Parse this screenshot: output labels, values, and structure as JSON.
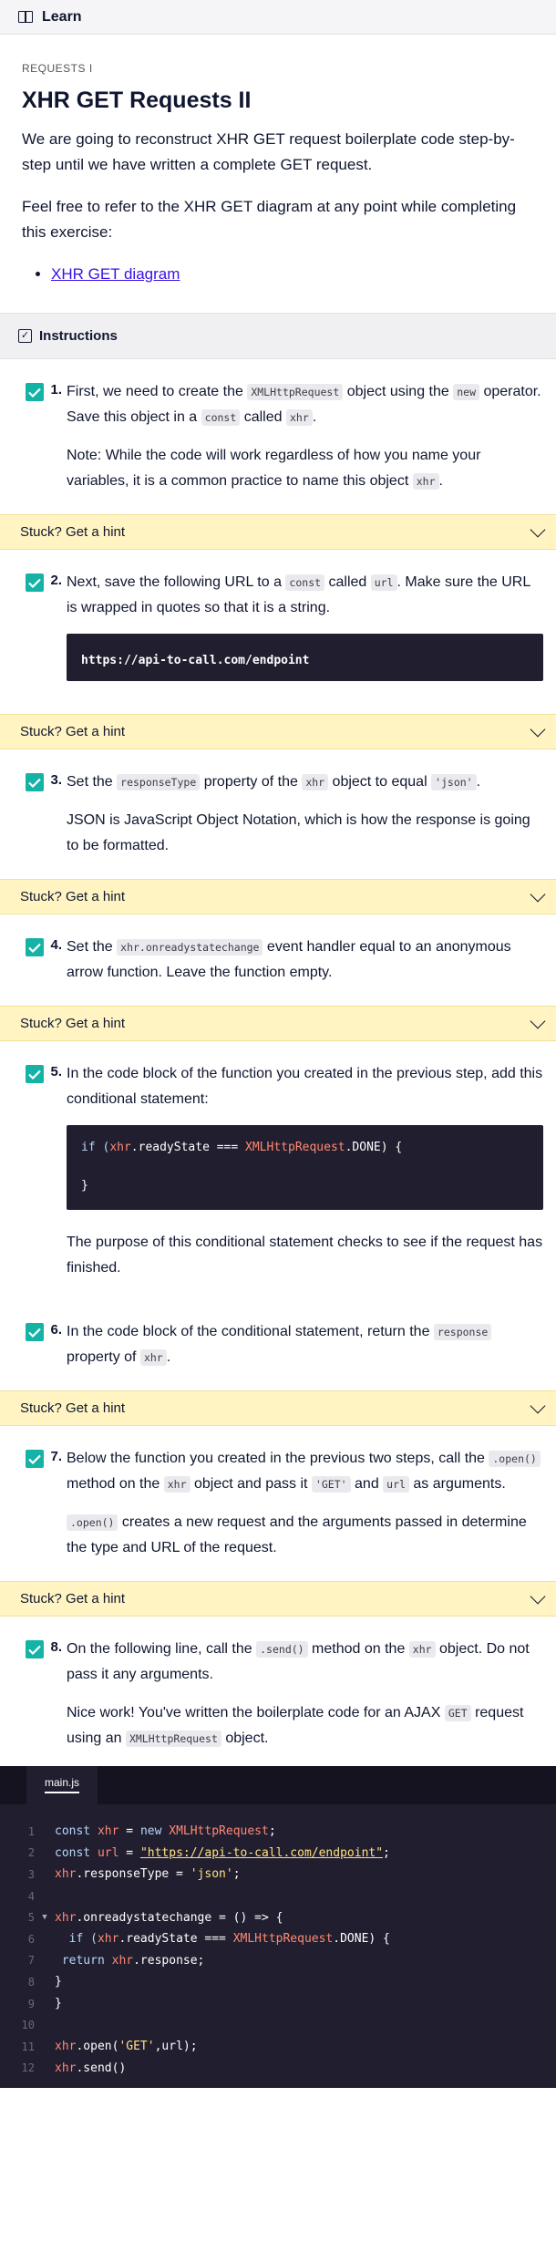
{
  "topbar": {
    "title": "Learn"
  },
  "learn": {
    "eyebrow": "REQUESTS I",
    "title": "XHR GET Requests II",
    "para1": "We are going to reconstruct XHR GET request boilerplate code step-by-step until we have written a complete GET request.",
    "para2": "Feel free to refer to the XHR GET diagram at any point while completing this exercise:",
    "link": "XHR GET diagram"
  },
  "instructions": {
    "title": "Instructions"
  },
  "hint_label": "Stuck? Get a hint",
  "tasks": [
    {
      "num": "1.",
      "status": "complete"
    },
    {
      "num": "2.",
      "status": "complete"
    },
    {
      "num": "3.",
      "status": "complete"
    },
    {
      "num": "4.",
      "status": "complete"
    },
    {
      "num": "5.",
      "status": "complete"
    },
    {
      "num": "6.",
      "status": "complete"
    },
    {
      "num": "7.",
      "status": "complete"
    },
    {
      "num": "8.",
      "status": "complete"
    }
  ],
  "t1": {
    "a": "First, we need to create the ",
    "b": "XMLHttpRequest",
    "c": " object using the ",
    "d": "new",
    "e": " operator. Save this object in a ",
    "f": "const",
    "g": " called ",
    "h": "xhr",
    "i": ".",
    "note": "Note: While the code will work regardless of how you name your variables, it is a common practice to name this object ",
    "note_code": "xhr",
    "note_end": "."
  },
  "t2": {
    "a": "Next, save the following URL to a ",
    "b": "const",
    "c": " called ",
    "d": "url",
    "e": ". Make sure the URL is wrapped in quotes so that it is a string.",
    "code": "https://api-to-call.com/endpoint"
  },
  "t3": {
    "a": "Set the ",
    "b": "responseType",
    "c": " property of the ",
    "d": "xhr",
    "e": " object to equal ",
    "f": "'json'",
    "g": ".",
    "note": "JSON is JavaScript Object Notation, which is how the response is going to be formatted."
  },
  "t4": {
    "a": "Set the ",
    "b": "xhr.onreadystatechange",
    "c": " event handler equal to an anonymous arrow function. Leave the function empty."
  },
  "t5": {
    "a": "In the code block of the function you created in the previous step, add this conditional statement:",
    "code1_a": "if (",
    "code1_b": "xhr",
    "code1_c": ".readyState === ",
    "code1_d": "XMLHttpRequest",
    "code1_e": ".DONE) {",
    "code2": "}",
    "note": "The purpose of this conditional statement checks to see if the request has finished."
  },
  "t6": {
    "a": "In the code block of the conditional statement, return the ",
    "b": "response",
    "c": " property of ",
    "d": "xhr",
    "e": "."
  },
  "t7": {
    "a": "Below the function you created in the previous two steps, call the ",
    "b": ".open()",
    "c": " method on the ",
    "d": "xhr",
    "e": " object and pass it ",
    "f": "'GET'",
    "g": " and ",
    "h": "url",
    "i": " as arguments.",
    "note_code": ".open()",
    "note": " creates a new request and the arguments passed in determine the type and URL of the request."
  },
  "t8": {
    "a": "On the following line, call the ",
    "b": ".send()",
    "c": " method on the ",
    "d": "xhr",
    "e": " object. Do not pass it any arguments.",
    "note": "Nice work! You've written the boilerplate code for an AJAX ",
    "note_code": "GET",
    "note2": " request using an ",
    "note_code2": "XMLHttpRequest",
    "note3": " object."
  },
  "editor": {
    "tab": "main.js",
    "line_numbers": [
      "1",
      "2",
      "3",
      "4",
      "5",
      "6",
      "7",
      "8",
      "9",
      "10",
      "11",
      "12"
    ],
    "l1": {
      "a": "const ",
      "b": "xhr",
      "c": " = ",
      "d": "new ",
      "e": "XMLHttpRequest",
      "f": ";"
    },
    "l2": {
      "a": "const ",
      "b": "url",
      "c": " = ",
      "d": "\"https://api-to-call.com/endpoint\"",
      "e": ";"
    },
    "l3": {
      "a": "xhr",
      "b": ".responseType = ",
      "c": "'json'",
      "d": ";"
    },
    "l5": {
      "a": "xhr",
      "b": ".onreadystatechange = () => {"
    },
    "l6": {
      "a": "  if (",
      "b": "xhr",
      "c": ".readyState === ",
      "d": "XMLHttpRequest",
      "e": ".DONE) {"
    },
    "l7": {
      "a": " return ",
      "b": "xhr",
      "c": ".response;"
    },
    "l8": "}",
    "l9": "}",
    "l11": {
      "a": "xhr",
      "b": ".open(",
      "c": "'GET'",
      "d": ",url);"
    },
    "l12": {
      "a": "xhr",
      "b": ".send()"
    }
  },
  "colors": {
    "check": "#15b3a6",
    "hint_bg": "#fff4c2",
    "code_bg": "#211e2f",
    "link": "#3a10e5"
  }
}
